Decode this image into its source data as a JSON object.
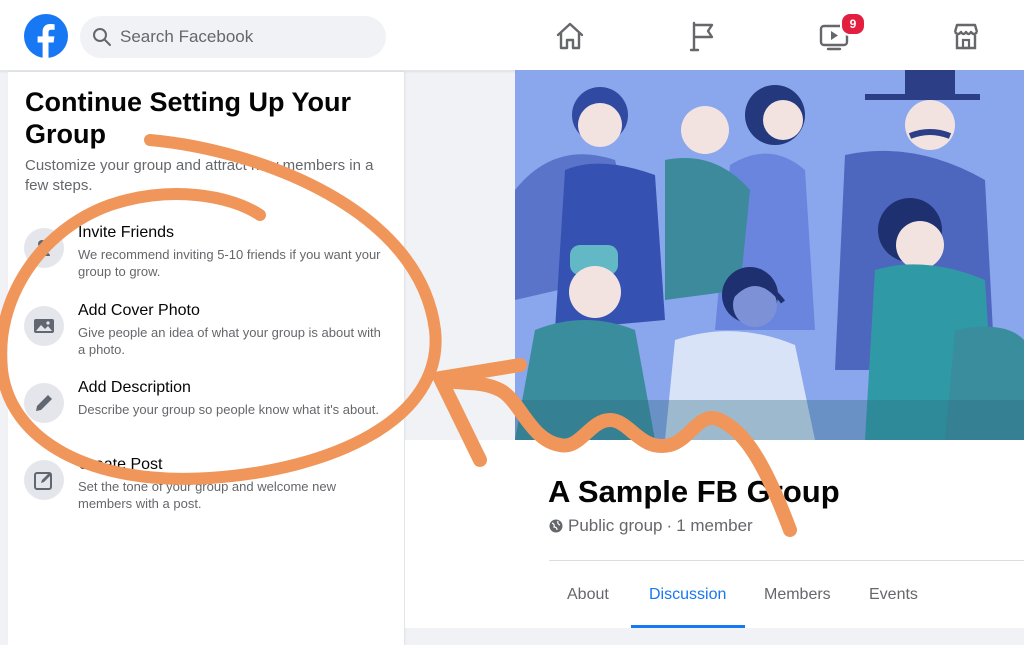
{
  "search": {
    "placeholder": "Search Facebook"
  },
  "nav": {
    "watch_badge": "9"
  },
  "setup": {
    "title": "Continue Setting Up Your Group",
    "subtitle": "Customize your group and attract new members in a few steps.",
    "steps": [
      {
        "title": "Invite Friends",
        "description": "We recommend inviting 5-10 friends if you want your group to grow.",
        "icon": "add-person-icon"
      },
      {
        "title": "Add Cover Photo",
        "description": "Give people an idea of what your group is about with a photo.",
        "icon": "image-icon"
      },
      {
        "title": "Add Description",
        "description": "Describe your group so people know what it's about.",
        "icon": "pencil-icon"
      },
      {
        "title": "Create Post",
        "description": "Set the tone of your group and welcome new members with a post.",
        "icon": "edit-box-icon"
      }
    ]
  },
  "group": {
    "name": "A Sample FB Group",
    "privacy": "Public group",
    "separator": "·",
    "members": "1 member"
  },
  "tabs": [
    {
      "label": "About",
      "active": false
    },
    {
      "label": "Discussion",
      "active": true
    },
    {
      "label": "Members",
      "active": false
    },
    {
      "label": "Events",
      "active": false
    }
  ],
  "colors": {
    "brand": "#1877f2",
    "annotation": "#f0965a",
    "badge": "#e41e3f"
  }
}
